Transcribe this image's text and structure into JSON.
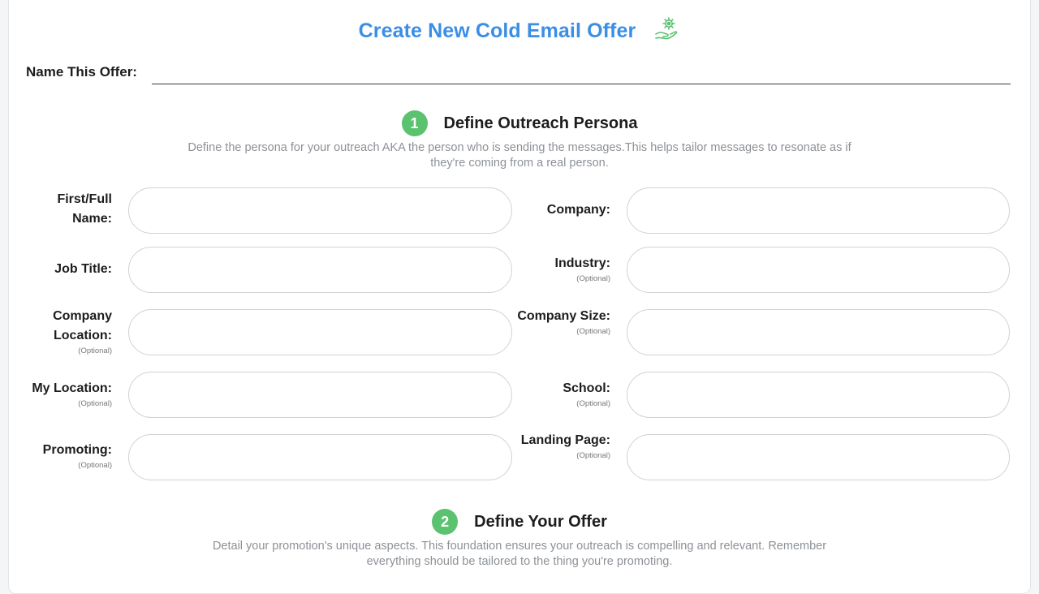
{
  "page": {
    "title": "Create New Cold Email Offer",
    "title_icon": "hand-gear-icon",
    "accent_color": "#3a8ee6",
    "step_color": "#5bc26f"
  },
  "offer_name": {
    "label": "Name This Offer:",
    "value": "",
    "placeholder": ""
  },
  "section1": {
    "number": "1",
    "title": "Define Outreach Persona",
    "description": "Define the persona for your outreach AKA the person who is sending the messages.This helps tailor messages to resonate as if they're coming from a real person."
  },
  "fields": {
    "first_name": {
      "label": "First/Full Name:",
      "value": ""
    },
    "company": {
      "label": "Company:",
      "value": ""
    },
    "job_title": {
      "label": "Job Title:",
      "value": ""
    },
    "industry": {
      "label": "Industry:",
      "optional": "(Optional)",
      "value": ""
    },
    "company_location": {
      "label": "Company Location:",
      "optional": "(Optional)",
      "value": ""
    },
    "company_size": {
      "label": "Company Size:",
      "optional": "(Optional)",
      "value": ""
    },
    "my_location": {
      "label": "My Location:",
      "optional": "(Optional)",
      "value": ""
    },
    "school": {
      "label": "School:",
      "optional": "(Optional)",
      "value": ""
    },
    "promoting": {
      "label": "Promoting:",
      "optional": "(Optional)",
      "value": ""
    },
    "landing_page": {
      "label": "Landing Page:",
      "optional": "(Optional)",
      "value": ""
    }
  },
  "section2": {
    "number": "2",
    "title": "Define Your Offer",
    "description": "Detail your promotion's unique aspects. This foundation ensures your outreach is  compelling and relevant. Remember everything should be tailored to the thing you're promoting."
  }
}
